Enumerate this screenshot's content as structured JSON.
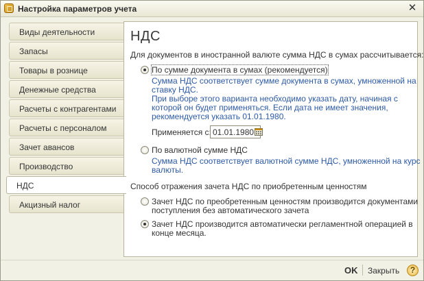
{
  "window": {
    "title": "Настройка параметров учета",
    "close_icon": "close-icon"
  },
  "tabs": [
    {
      "label": "Виды деятельности",
      "active": false
    },
    {
      "label": "Запасы",
      "active": false
    },
    {
      "label": "Товары в рознице",
      "active": false
    },
    {
      "label": "Денежные средства",
      "active": false
    },
    {
      "label": "Расчеты с контрагентами",
      "active": false
    },
    {
      "label": "Расчеты с персоналом",
      "active": false
    },
    {
      "label": "Зачет авансов",
      "active": false
    },
    {
      "label": "Производство",
      "active": false
    },
    {
      "label": "НДС",
      "active": true
    },
    {
      "label": "Акцизный налог",
      "active": false
    }
  ],
  "panel": {
    "heading": "НДС",
    "prompt": "Для документов в иностранной валюте сумма НДС в сумах рассчитывается:",
    "option1": {
      "label": "По сумме документа в сумах (рекомендуется)",
      "checked": true,
      "hint": [
        "Сумма НДС соответствует сумме документа в сумах, умноженной на",
        "ставку НДС.",
        "При выборе этого варианта необходимо указать дату, начиная с",
        "которой он будет применяться. Если дата не имеет значения,",
        "рекомендуется указать 01.01.1980."
      ],
      "date_label": "Применяется с:",
      "date_value": "01.01.1980"
    },
    "option2": {
      "label": "По валютной сумме НДС",
      "checked": false,
      "hint": [
        "Сумма НДС соответствует валютной сумме НДС, умноженной на курс",
        "валюты."
      ]
    },
    "section_label": "Способ отражения зачета НДС по приобретенным ценностям",
    "option3": {
      "lines": [
        "Зачет НДС по преобретенным ценностям производится документами",
        "поступления без автоматического зачета"
      ],
      "checked": false
    },
    "option4": {
      "lines": [
        "Зачет НДС производится автоматически регламентной операцией в",
        "конце месяца."
      ],
      "checked": true
    }
  },
  "footer": {
    "ok_label": "OK",
    "close_label": "Закрыть",
    "help_label": "?"
  },
  "colors": {
    "hint_text": "#2d5aa6",
    "window_bg": "#f2f1e6",
    "panel_bg": "#ffffff"
  }
}
